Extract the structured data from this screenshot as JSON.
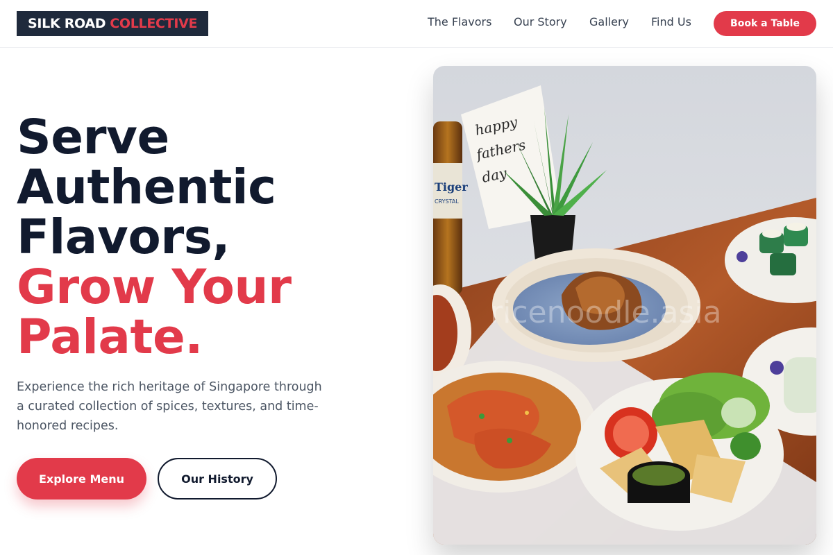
{
  "brand": {
    "name_part1": "SILK ROAD",
    "name_part2": "COLLECTIVE"
  },
  "nav": {
    "items": [
      {
        "label": "The Flavors"
      },
      {
        "label": "Our Story"
      },
      {
        "label": "Gallery"
      },
      {
        "label": "Find Us"
      }
    ],
    "cta_label": "Book a Table"
  },
  "hero": {
    "headline_lines_dark": [
      "Serve",
      "Authentic",
      "Flavors,"
    ],
    "headline_lines_red": [
      "Grow Your",
      "Palate."
    ],
    "description": "Experience the rich heritage of Singapore through a curated collection of spices, textures, and time-honored recipes.",
    "primary_button": "Explore Menu",
    "secondary_button": "Our History"
  },
  "photo": {
    "card_text": [
      "happy",
      "fathers",
      "day"
    ],
    "bottle_text": [
      "Tiger",
      "CRYSTAL"
    ],
    "watermark": "ricenoodle.asia"
  },
  "colors": {
    "accent": "#e23a4a",
    "navy": "#1f2a3c",
    "text_dark": "#111a2e",
    "text_muted": "#4b5563"
  }
}
